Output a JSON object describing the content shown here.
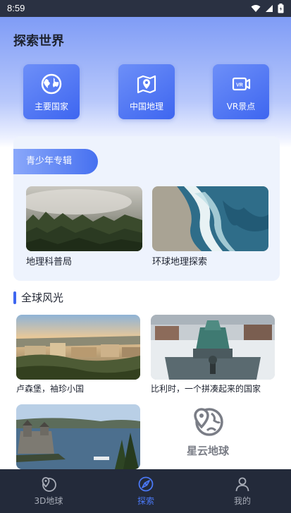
{
  "status_bar": {
    "time": "8:59"
  },
  "header": {
    "title": "探索世界"
  },
  "categories": [
    {
      "label": "主要国家",
      "icon": "globe-icon"
    },
    {
      "label": "中国地理",
      "icon": "map-pin-icon"
    },
    {
      "label": "VR景点",
      "icon": "vr-icon"
    }
  ],
  "youth": {
    "tab_label": "青少年专辑",
    "items": [
      {
        "caption": "地理科普局"
      },
      {
        "caption": "环球地理探索"
      }
    ]
  },
  "global_scenery": {
    "title": "全球风光",
    "items": [
      {
        "caption": "卢森堡，袖珍小国"
      },
      {
        "caption": "比利时，一个拼凑起来的国家"
      },
      {
        "caption": ""
      }
    ]
  },
  "brand": {
    "name": "星云地球"
  },
  "tabbar": {
    "items": [
      {
        "label": "3D地球",
        "icon": "earth-icon",
        "active": false
      },
      {
        "label": "探索",
        "icon": "compass-icon",
        "active": true
      },
      {
        "label": "我的",
        "icon": "person-icon",
        "active": false
      }
    ]
  },
  "colors": {
    "accent": "#3e66f0",
    "tabbar_bg": "#232a3a",
    "active_tab": "#4a78f5"
  }
}
